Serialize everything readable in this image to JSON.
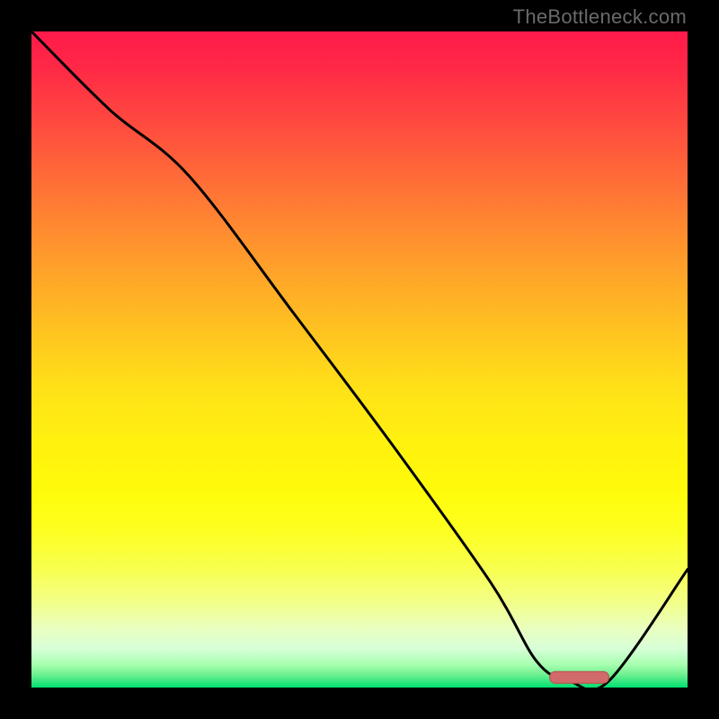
{
  "watermark": "TheBottleneck.com",
  "colors": {
    "background": "#000000",
    "watermark": "#6a6a6a",
    "curve": "#000000",
    "marker": "#d16a6a",
    "marker_outline": "#b94a4a"
  },
  "chart_data": {
    "type": "line",
    "title": "",
    "xlabel": "",
    "ylabel": "",
    "xlim": [
      0,
      100
    ],
    "ylim": [
      0,
      100
    ],
    "grid": false,
    "legend": false,
    "series": [
      {
        "name": "bottleneck_curve",
        "x": [
          0,
          12,
          24,
          40,
          55,
          70,
          77,
          82,
          88,
          100
        ],
        "values": [
          100,
          88,
          78,
          57,
          37,
          16,
          4,
          1,
          1,
          18
        ],
        "note": "y=0 is bottom (best / green), y=100 is top (worst / red). Values are read from the picture with ~2% precision."
      }
    ],
    "marker": {
      "name": "optimal_range",
      "x_start": 79,
      "x_end": 88,
      "y": 0.8
    },
    "background_gradient": {
      "orientation": "vertical",
      "stops": [
        {
          "pos": 0.0,
          "color": "#ff1a4a"
        },
        {
          "pos": 0.3,
          "color": "#ff8a30"
        },
        {
          "pos": 0.55,
          "color": "#ffe018"
        },
        {
          "pos": 0.82,
          "color": "#f8ff50"
        },
        {
          "pos": 0.94,
          "color": "#d8ffd8"
        },
        {
          "pos": 1.0,
          "color": "#00e070"
        }
      ]
    }
  }
}
